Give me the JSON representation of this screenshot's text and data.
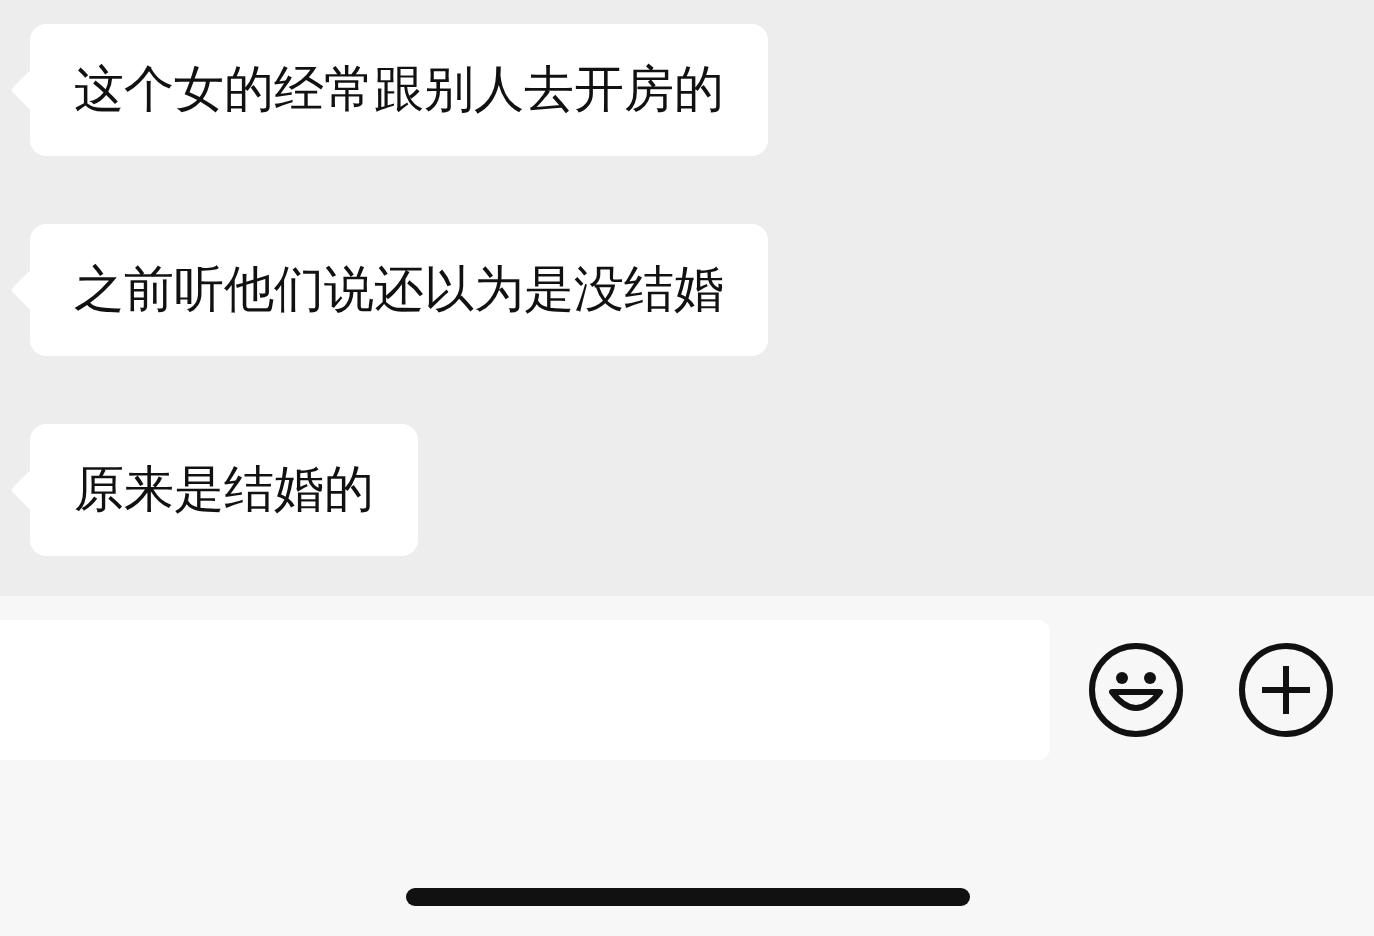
{
  "messages": [
    {
      "text": "这个女的经常跟别人去开房的"
    },
    {
      "text": "之前听他们说还以为是没结婚"
    },
    {
      "text": "原来是结婚的"
    }
  ]
}
